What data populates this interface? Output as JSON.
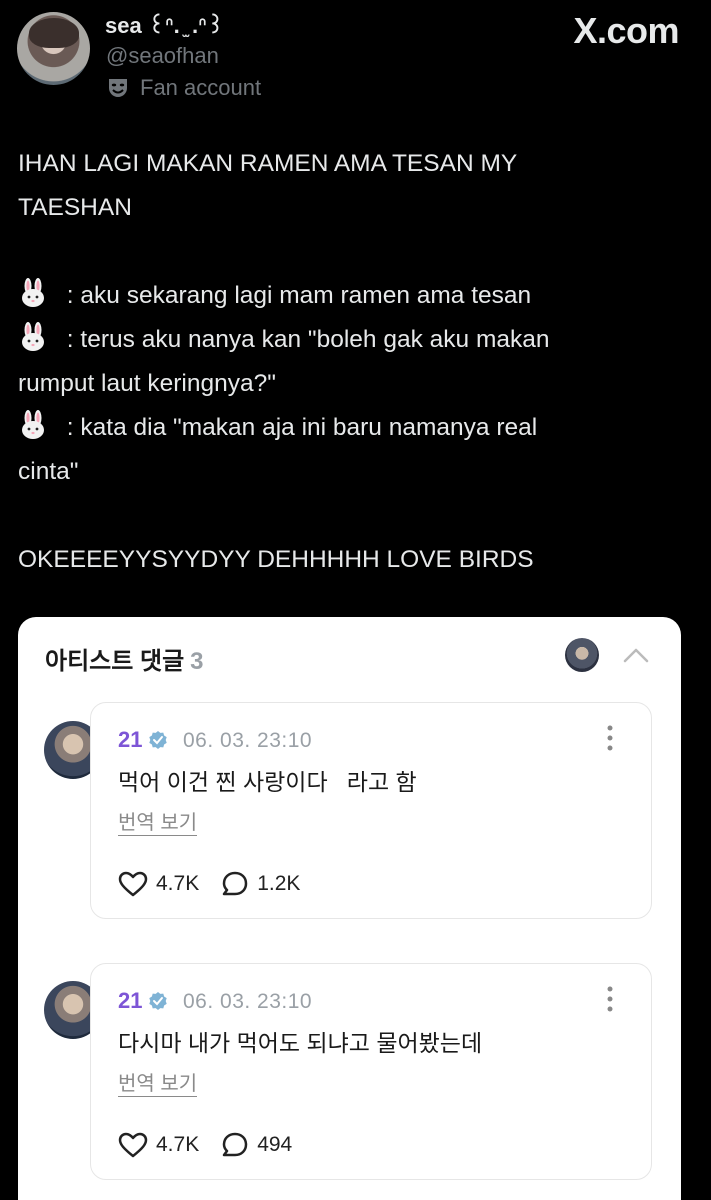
{
  "profile": {
    "display_name": "sea ꒰ᐢ. ̫ .ᐢ꒱",
    "handle": "@seaofhan",
    "label": "Fan account",
    "label_icon": "performing-arts-mask-icon"
  },
  "watermark": "X.com",
  "tweet": {
    "lines": [
      "IHAN LAGI MAKAN RAMEN AMA TESAN MY",
      "TAESHAN",
      "",
      " : aku sekarang lagi mam ramen ama tesan",
      " : terus aku nanya kan \"boleh gak aku makan",
      "rumput laut keringnya?\"",
      " : kata dia \"makan aja ini baru namanya real",
      "cinta\"",
      "",
      "OKEEEEYYSYYDYY DEHHHHH LOVE BIRDS"
    ],
    "emoji_icon": "rabbit-face-icon"
  },
  "card": {
    "title": "아티스트 댓글",
    "count": "3",
    "comments": [
      {
        "author": "21",
        "time": "06. 03. 23:10",
        "text": "먹어 이건 찐 사랑이다   라고 함",
        "translate": "번역 보기",
        "likes": "4.7K",
        "replies": "1.2K"
      },
      {
        "author": "21",
        "time": "06. 03. 23:10",
        "text": "다시마 내가 먹어도 되냐고 물어봤는데",
        "translate": "번역 보기",
        "likes": "4.7K",
        "replies": "494"
      }
    ]
  },
  "colors": {
    "background": "#000000",
    "text_primary": "#e7e9ea",
    "text_secondary": "#71767b",
    "artist_name": "#7d55d6",
    "verified_badge": "#7fb3d5"
  }
}
